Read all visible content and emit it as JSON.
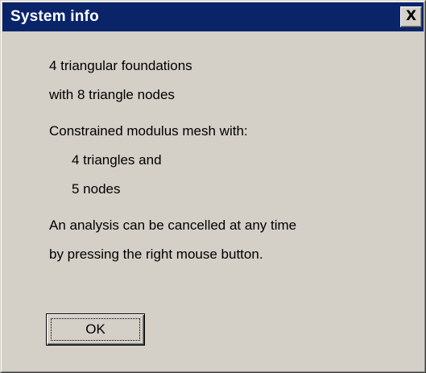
{
  "window": {
    "title": "System info",
    "close_glyph": "X"
  },
  "message": {
    "foundations_line1": "4 triangular foundations",
    "foundations_line2": "with 8 triangle nodes",
    "mesh_heading": "Constrained modulus mesh with:",
    "mesh_triangles": "4 triangles and",
    "mesh_nodes": "5 nodes",
    "cancel_line1": "An analysis can be cancelled at any time",
    "cancel_line2": "by pressing the right mouse button."
  },
  "buttons": {
    "ok_label": "OK"
  },
  "colors": {
    "titlebar": "#0a246a",
    "dialog_face": "#d4d0c8"
  }
}
